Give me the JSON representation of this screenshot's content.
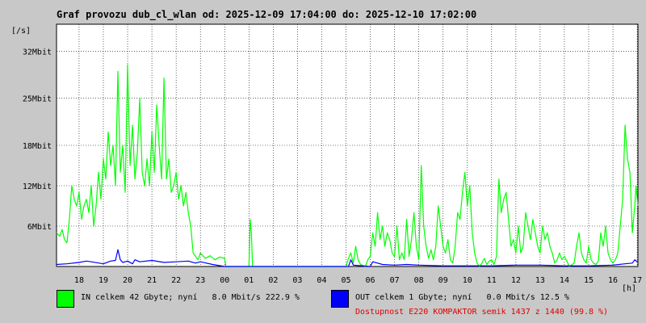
{
  "chart_data": {
    "type": "line",
    "title": "Graf provozu dub_cl_wlan od: 2025-12-09 17:04:00 do: 2025-12-10 17:02:00",
    "ylabel": "[/s]",
    "xlabel": "[h]",
    "ylim": [
      0,
      36
    ],
    "y_ticks": [
      {
        "value": 6,
        "label": "6Mbit"
      },
      {
        "value": 12,
        "label": "12Mbit"
      },
      {
        "value": 18,
        "label": "18Mbit"
      },
      {
        "value": 25,
        "label": "25Mbit"
      },
      {
        "value": 32,
        "label": "32Mbit"
      }
    ],
    "x_range_hours": [
      17.07,
      41.03
    ],
    "x_ticks": [
      {
        "value": 18,
        "label": "18"
      },
      {
        "value": 19,
        "label": "19"
      },
      {
        "value": 20,
        "label": "20"
      },
      {
        "value": 21,
        "label": "21"
      },
      {
        "value": 22,
        "label": "22"
      },
      {
        "value": 23,
        "label": "23"
      },
      {
        "value": 24,
        "label": "00"
      },
      {
        "value": 25,
        "label": "01"
      },
      {
        "value": 26,
        "label": "02"
      },
      {
        "value": 27,
        "label": "03"
      },
      {
        "value": 28,
        "label": "04"
      },
      {
        "value": 29,
        "label": "05"
      },
      {
        "value": 30,
        "label": "06"
      },
      {
        "value": 31,
        "label": "07"
      },
      {
        "value": 32,
        "label": "08"
      },
      {
        "value": 33,
        "label": "09"
      },
      {
        "value": 34,
        "label": "10"
      },
      {
        "value": 35,
        "label": "11"
      },
      {
        "value": 36,
        "label": "12"
      },
      {
        "value": 37,
        "label": "13"
      },
      {
        "value": 38,
        "label": "14"
      },
      {
        "value": 39,
        "label": "15"
      },
      {
        "value": 40,
        "label": "16"
      },
      {
        "value": 41,
        "label": "17"
      }
    ],
    "grid": true,
    "series": [
      {
        "name": "IN",
        "color": "#00ff00",
        "points": [
          [
            17.07,
            5
          ],
          [
            17.2,
            4.5
          ],
          [
            17.3,
            5.5
          ],
          [
            17.4,
            4
          ],
          [
            17.5,
            3.5
          ],
          [
            17.6,
            7
          ],
          [
            17.7,
            12
          ],
          [
            17.8,
            10
          ],
          [
            17.9,
            9
          ],
          [
            18.0,
            11
          ],
          [
            18.1,
            7
          ],
          [
            18.2,
            9
          ],
          [
            18.3,
            10
          ],
          [
            18.4,
            8
          ],
          [
            18.5,
            12
          ],
          [
            18.6,
            6
          ],
          [
            18.7,
            9
          ],
          [
            18.8,
            14
          ],
          [
            18.9,
            10
          ],
          [
            19.0,
            16
          ],
          [
            19.1,
            13
          ],
          [
            19.2,
            20
          ],
          [
            19.3,
            15
          ],
          [
            19.4,
            18
          ],
          [
            19.5,
            12
          ],
          [
            19.6,
            29
          ],
          [
            19.7,
            14
          ],
          [
            19.8,
            18
          ],
          [
            19.9,
            11
          ],
          [
            20.0,
            30
          ],
          [
            20.1,
            15
          ],
          [
            20.2,
            21
          ],
          [
            20.3,
            13
          ],
          [
            20.4,
            17
          ],
          [
            20.5,
            25
          ],
          [
            20.6,
            14
          ],
          [
            20.7,
            12
          ],
          [
            20.8,
            16
          ],
          [
            20.9,
            12
          ],
          [
            21.0,
            20
          ],
          [
            21.1,
            14
          ],
          [
            21.2,
            24
          ],
          [
            21.3,
            18
          ],
          [
            21.4,
            13
          ],
          [
            21.5,
            28
          ],
          [
            21.6,
            13
          ],
          [
            21.7,
            16
          ],
          [
            21.8,
            11
          ],
          [
            21.9,
            12
          ],
          [
            22.0,
            14
          ],
          [
            22.1,
            10
          ],
          [
            22.2,
            12
          ],
          [
            22.3,
            9
          ],
          [
            22.4,
            11
          ],
          [
            22.5,
            8
          ],
          [
            22.6,
            6
          ],
          [
            22.7,
            2
          ],
          [
            22.8,
            1.5
          ],
          [
            22.9,
            1
          ],
          [
            23.0,
            2
          ],
          [
            23.2,
            1.2
          ],
          [
            23.4,
            1.6
          ],
          [
            23.6,
            1.0
          ],
          [
            23.8,
            1.4
          ],
          [
            24.0,
            1.2
          ],
          [
            24.05,
            0
          ],
          [
            25.0,
            0
          ],
          [
            25.05,
            7
          ],
          [
            25.1,
            5
          ],
          [
            25.15,
            0
          ],
          [
            29.0,
            0
          ],
          [
            29.1,
            1.2
          ],
          [
            29.2,
            2
          ],
          [
            29.3,
            0.5
          ],
          [
            29.4,
            3
          ],
          [
            29.5,
            1
          ],
          [
            29.6,
            0.3
          ],
          [
            29.8,
            0
          ],
          [
            29.9,
            1
          ],
          [
            30.0,
            1.5
          ],
          [
            30.1,
            5
          ],
          [
            30.2,
            3
          ],
          [
            30.3,
            8
          ],
          [
            30.4,
            4
          ],
          [
            30.5,
            6
          ],
          [
            30.6,
            3
          ],
          [
            30.7,
            5
          ],
          [
            30.8,
            4
          ],
          [
            30.9,
            2
          ],
          [
            31.0,
            1.5
          ],
          [
            31.1,
            6
          ],
          [
            31.2,
            1
          ],
          [
            31.3,
            2
          ],
          [
            31.4,
            1
          ],
          [
            31.5,
            7
          ],
          [
            31.6,
            1.5
          ],
          [
            31.7,
            4
          ],
          [
            31.8,
            8
          ],
          [
            31.9,
            3
          ],
          [
            32.0,
            1
          ],
          [
            32.1,
            15
          ],
          [
            32.2,
            6
          ],
          [
            32.3,
            3
          ],
          [
            32.4,
            1.2
          ],
          [
            32.5,
            2.5
          ],
          [
            32.6,
            1
          ],
          [
            32.7,
            3
          ],
          [
            32.8,
            9
          ],
          [
            32.9,
            6
          ],
          [
            33.0,
            3
          ],
          [
            33.1,
            2
          ],
          [
            33.2,
            4
          ],
          [
            33.3,
            1
          ],
          [
            33.4,
            0.5
          ],
          [
            33.5,
            3
          ],
          [
            33.6,
            8
          ],
          [
            33.7,
            7
          ],
          [
            33.8,
            11
          ],
          [
            33.9,
            14
          ],
          [
            34.0,
            9
          ],
          [
            34.1,
            12
          ],
          [
            34.2,
            5
          ],
          [
            34.3,
            2
          ],
          [
            34.4,
            0.5
          ],
          [
            34.5,
            0
          ],
          [
            34.6,
            0.5
          ],
          [
            34.7,
            1.2
          ],
          [
            34.8,
            0.3
          ],
          [
            34.9,
            0.8
          ],
          [
            35.0,
            1
          ],
          [
            35.1,
            0.3
          ],
          [
            35.2,
            1.5
          ],
          [
            35.3,
            13
          ],
          [
            35.4,
            8
          ],
          [
            35.5,
            10
          ],
          [
            35.6,
            11
          ],
          [
            35.7,
            7
          ],
          [
            35.8,
            3
          ],
          [
            35.9,
            4
          ],
          [
            36.0,
            2
          ],
          [
            36.1,
            6
          ],
          [
            36.2,
            2
          ],
          [
            36.3,
            3
          ],
          [
            36.4,
            8
          ],
          [
            36.5,
            6
          ],
          [
            36.6,
            4
          ],
          [
            36.7,
            7
          ],
          [
            36.8,
            5
          ],
          [
            36.9,
            3
          ],
          [
            37.0,
            2
          ],
          [
            37.1,
            6
          ],
          [
            37.2,
            4
          ],
          [
            37.3,
            5
          ],
          [
            37.4,
            3
          ],
          [
            37.5,
            2
          ],
          [
            37.6,
            0.5
          ],
          [
            37.7,
            1
          ],
          [
            37.8,
            2
          ],
          [
            37.9,
            1
          ],
          [
            38.0,
            1.5
          ],
          [
            38.1,
            0.8
          ],
          [
            38.2,
            0
          ],
          [
            38.4,
            0.5
          ],
          [
            38.5,
            3
          ],
          [
            38.6,
            5
          ],
          [
            38.7,
            2
          ],
          [
            38.8,
            1
          ],
          [
            38.9,
            0.5
          ],
          [
            39.0,
            3
          ],
          [
            39.1,
            1
          ],
          [
            39.2,
            0.5
          ],
          [
            39.3,
            0.3
          ],
          [
            39.4,
            0.8
          ],
          [
            39.5,
            5
          ],
          [
            39.6,
            3
          ],
          [
            39.7,
            6
          ],
          [
            39.8,
            2
          ],
          [
            39.9,
            1
          ],
          [
            40.0,
            0.5
          ],
          [
            40.1,
            1
          ],
          [
            40.2,
            2
          ],
          [
            40.3,
            6
          ],
          [
            40.4,
            10
          ],
          [
            40.5,
            21
          ],
          [
            40.6,
            16
          ],
          [
            40.7,
            14
          ],
          [
            40.8,
            5
          ],
          [
            40.9,
            9
          ],
          [
            40.95,
            12
          ],
          [
            41.03,
            9
          ]
        ]
      },
      {
        "name": "OUT",
        "color": "#0000ff",
        "points": [
          [
            17.07,
            0.3
          ],
          [
            17.5,
            0.4
          ],
          [
            18.0,
            0.6
          ],
          [
            18.3,
            0.8
          ],
          [
            18.5,
            0.7
          ],
          [
            19.0,
            0.4
          ],
          [
            19.3,
            0.8
          ],
          [
            19.5,
            0.9
          ],
          [
            19.6,
            2.5
          ],
          [
            19.7,
            1.0
          ],
          [
            19.8,
            0.6
          ],
          [
            20.0,
            0.8
          ],
          [
            20.2,
            0.4
          ],
          [
            20.3,
            1.0
          ],
          [
            20.5,
            0.7
          ],
          [
            21.0,
            0.9
          ],
          [
            21.5,
            0.6
          ],
          [
            22.0,
            0.7
          ],
          [
            22.5,
            0.8
          ],
          [
            22.8,
            0.5
          ],
          [
            23.0,
            0.7
          ],
          [
            23.5,
            0.3
          ],
          [
            24.0,
            0
          ],
          [
            29.1,
            0
          ],
          [
            29.2,
            1.0
          ],
          [
            29.3,
            0.2
          ],
          [
            30.0,
            0
          ],
          [
            30.1,
            0.7
          ],
          [
            30.5,
            0.3
          ],
          [
            31.0,
            0.2
          ],
          [
            31.5,
            0.3
          ],
          [
            32.0,
            0.2
          ],
          [
            33.0,
            0.1
          ],
          [
            34.0,
            0.1
          ],
          [
            35.0,
            0.1
          ],
          [
            36.0,
            0.2
          ],
          [
            37.0,
            0.2
          ],
          [
            38.0,
            0.1
          ],
          [
            39.0,
            0.1
          ],
          [
            40.0,
            0.2
          ],
          [
            40.5,
            0.4
          ],
          [
            40.8,
            0.5
          ],
          [
            40.9,
            1.0
          ],
          [
            41.03,
            0.6
          ]
        ]
      }
    ]
  },
  "legend": {
    "in_color": "#00ff00",
    "out_color": "#0000ff",
    "in_text": "IN celkem 42 Gbyte; nyní   8.0 Mbit/s 222.9 %",
    "out_text": "OUT celkem 1 Gbyte; nyní   0.0 Mbit/s 12.5 %",
    "availability_text": "Dostupnost E220 KOMPAKTOR semik 1437 z 1440 (99.8 %)",
    "availability_color": "#e00000"
  }
}
